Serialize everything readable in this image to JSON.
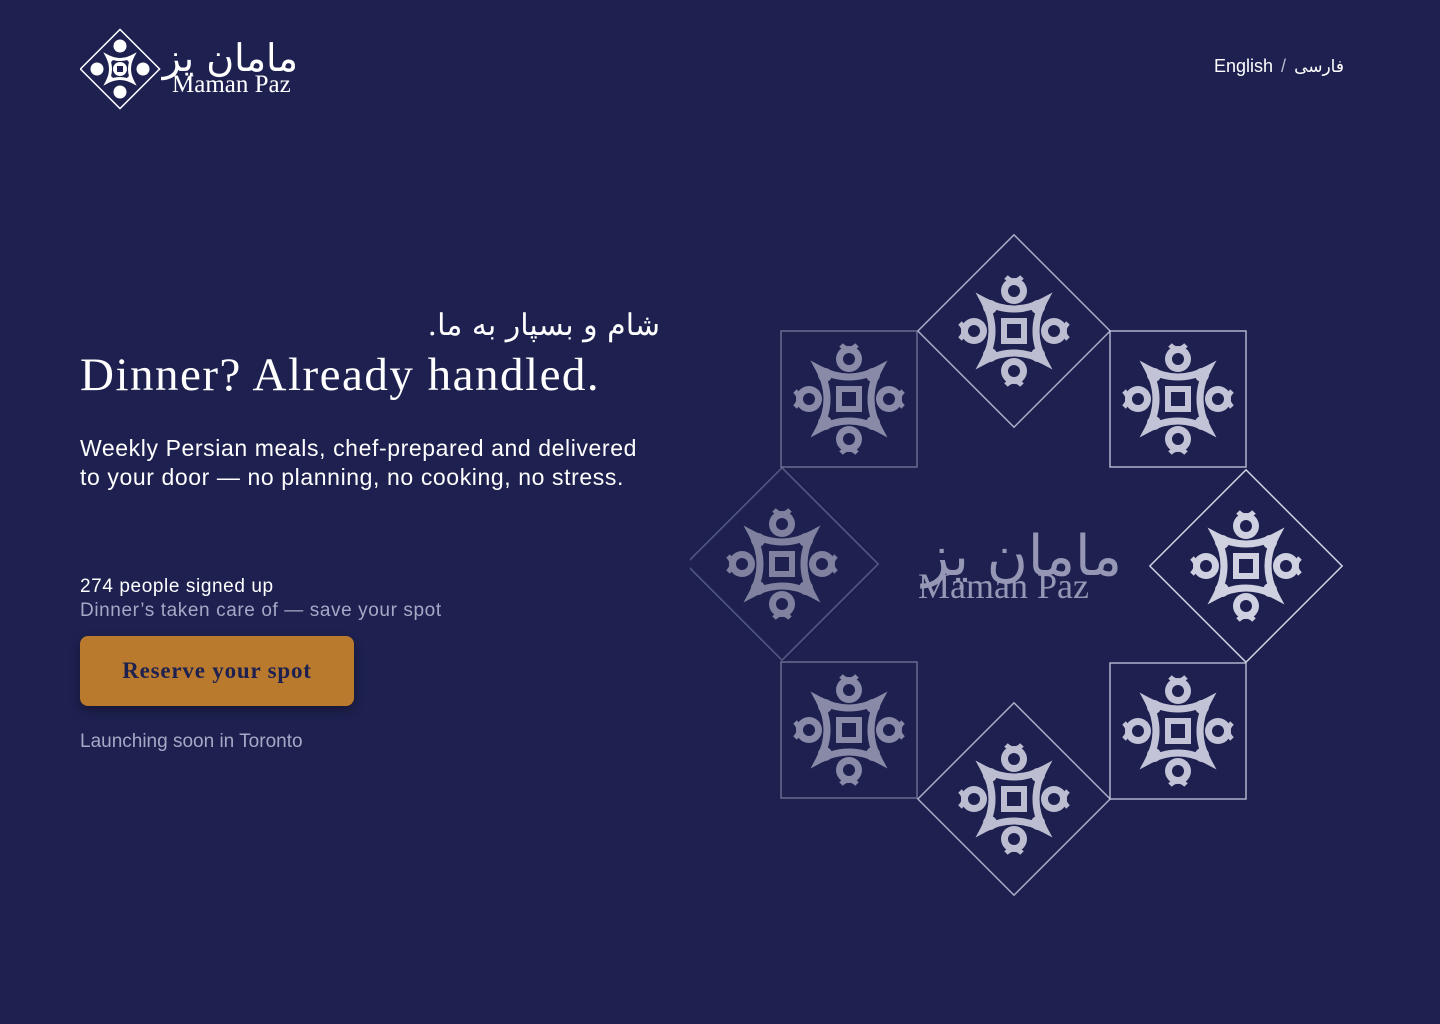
{
  "brand": {
    "name_en": "Maman Paz",
    "name_fa": "مامان پز"
  },
  "lang_switch": {
    "english": "English",
    "separator": "/",
    "farsi": "فارسی"
  },
  "hero": {
    "persian_tagline": "شام و بسپار به ما.",
    "headline": "Dinner? Already handled.",
    "subtitle": "Weekly Persian meals, chef-prepared and delivered to your door — no planning, no cooking, no stress."
  },
  "signup": {
    "count_text": "274 people signed up",
    "subtext": "Dinner’s taken care of — save your spot"
  },
  "cta": {
    "label": "Reserve your spot"
  },
  "launch_note": "Launching soon in Toronto",
  "colors": {
    "background": "#1e2150",
    "accent": "#b97a2d",
    "muted_text": "#a6a8c6"
  },
  "icons": [
    "tile-ornament-icon",
    "brand-logo"
  ]
}
